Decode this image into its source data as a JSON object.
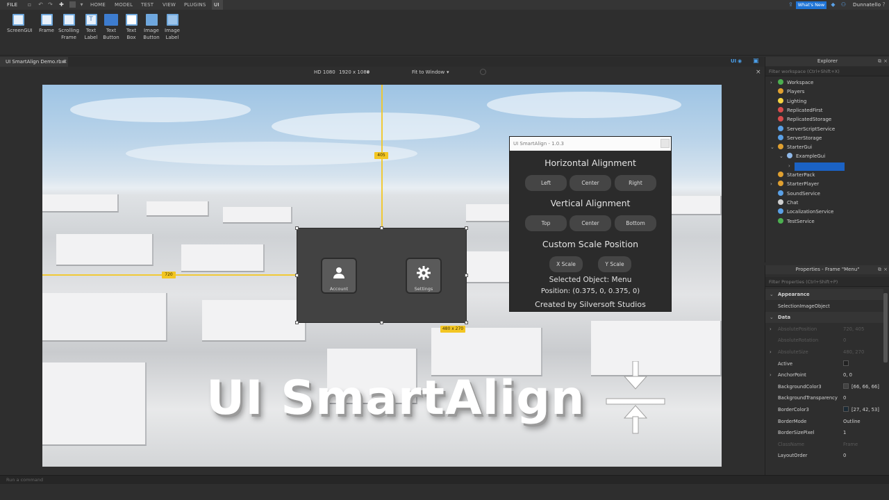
{
  "menubar": {
    "file_label": "FILE",
    "tabs": [
      "HOME",
      "MODEL",
      "TEST",
      "VIEW",
      "PLUGINS",
      "UI"
    ],
    "whats_new": "What's New",
    "username": "Dunnatello"
  },
  "ribbon": {
    "items": [
      {
        "label": "ScreenGUI",
        "icon": "screengui-icon"
      },
      {
        "label": "Frame",
        "icon": "frame-icon"
      },
      {
        "label": "Scrolling\nFrame",
        "icon": "scrolling-frame-icon"
      },
      {
        "label": "Text\nLabel",
        "icon": "text-label-icon"
      },
      {
        "label": "Text\nButton",
        "icon": "text-button-icon"
      },
      {
        "label": "Text\nBox",
        "icon": "text-box-icon"
      },
      {
        "label": "Image\nButton",
        "icon": "image-button-icon"
      },
      {
        "label": "Image\nLabel",
        "icon": "image-label-icon"
      }
    ]
  },
  "document_tab": "UI SmartAlign Demo.rbxl",
  "viewport_toolbar": {
    "device": "HD 1080",
    "resolution": "1920 x 1080",
    "fit": "Fit to Window",
    "ui_toggle": "UI"
  },
  "guides": {
    "vertical_badge": "405",
    "horizontal_badge": "720",
    "size_badge": "480 x 270"
  },
  "menu_frame": {
    "buttons": [
      {
        "label": "Account",
        "icon": "user-icon"
      },
      {
        "label": "Settings",
        "icon": "gear-icon"
      }
    ]
  },
  "widget": {
    "title": "UI SmartAlign - 1.0.3",
    "horizontal_heading": "Horizontal Alignment",
    "horizontal_buttons": [
      "Left",
      "Center",
      "Right"
    ],
    "vertical_heading": "Vertical Alignment",
    "vertical_buttons": [
      "Top",
      "Center",
      "Bottom"
    ],
    "scale_heading": "Custom Scale Position",
    "scale_buttons": [
      "X Scale",
      "Y Scale"
    ],
    "selected": "Selected Object: Menu",
    "position": "Position: (0.375, 0, 0.375, 0)",
    "credit": "Created by Silversoft Studios"
  },
  "banner_text": "UI SmartAlign",
  "explorer": {
    "title": "Explorer",
    "filter_placeholder": "Filter workspace (Ctrl+Shift+X)",
    "items": [
      {
        "label": "Workspace",
        "color": "#4caf50",
        "indent": 0,
        "arrow": true
      },
      {
        "label": "Players",
        "color": "#e0a030",
        "indent": 0,
        "arrow": false
      },
      {
        "label": "Lighting",
        "color": "#f5d442",
        "indent": 0,
        "arrow": false
      },
      {
        "label": "ReplicatedFirst",
        "color": "#d94c4c",
        "indent": 0,
        "arrow": false
      },
      {
        "label": "ReplicatedStorage",
        "color": "#d94c4c",
        "indent": 0,
        "arrow": false
      },
      {
        "label": "ServerScriptService",
        "color": "#5aa0e6",
        "indent": 0,
        "arrow": false
      },
      {
        "label": "ServerStorage",
        "color": "#5aa0e6",
        "indent": 0,
        "arrow": false
      },
      {
        "label": "StarterGui",
        "color": "#e0a030",
        "indent": 0,
        "arrow": true
      },
      {
        "label": "ExampleGui",
        "color": "#8fb8e8",
        "indent": 1,
        "arrow": true
      },
      {
        "label": "Menu",
        "color": "#cfe0f5",
        "indent": 2,
        "arrow": true
      },
      {
        "label": "StarterPack",
        "color": "#e0a030",
        "indent": 0,
        "arrow": false
      },
      {
        "label": "StarterPlayer",
        "color": "#e0a030",
        "indent": 0,
        "arrow": true
      },
      {
        "label": "SoundService",
        "color": "#5aa0e6",
        "indent": 0,
        "arrow": false
      },
      {
        "label": "Chat",
        "color": "#cfcfcf",
        "indent": 0,
        "arrow": false
      },
      {
        "label": "LocalizationService",
        "color": "#5aa0e6",
        "indent": 0,
        "arrow": false
      },
      {
        "label": "TestService",
        "color": "#4caf50",
        "indent": 0,
        "arrow": false
      }
    ]
  },
  "properties": {
    "title": "Properties - Frame \"Menu\"",
    "filter_placeholder": "Filter Properties (Ctrl+Shift+P)",
    "rows": [
      {
        "key": "Appearance",
        "value": "",
        "kind": "cat"
      },
      {
        "key": "SelectionImageObject",
        "value": "",
        "kind": "row"
      },
      {
        "key": "Data",
        "value": "",
        "kind": "cat"
      },
      {
        "key": "AbsolutePosition",
        "value": "720, 405",
        "kind": "dim"
      },
      {
        "key": "AbsoluteRotation",
        "value": "0",
        "kind": "dim"
      },
      {
        "key": "AbsoluteSize",
        "value": "480, 270",
        "kind": "dim"
      },
      {
        "key": "Active",
        "value": "",
        "kind": "row"
      },
      {
        "key": "AnchorPoint",
        "value": "0, 0",
        "kind": "row"
      },
      {
        "key": "BackgroundColor3",
        "value": "[66, 66, 66]",
        "kind": "row",
        "swatch": "#424242"
      },
      {
        "key": "BackgroundTransparency",
        "value": "0",
        "kind": "row"
      },
      {
        "key": "BorderColor3",
        "value": "[27, 42, 53]",
        "kind": "row",
        "swatch": "#1b2a35"
      },
      {
        "key": "BorderMode",
        "value": "Outline",
        "kind": "row"
      },
      {
        "key": "BorderSizePixel",
        "value": "1",
        "kind": "row"
      },
      {
        "key": "ClassName",
        "value": "Frame",
        "kind": "dim"
      },
      {
        "key": "LayoutOrder",
        "value": "0",
        "kind": "row"
      }
    ]
  },
  "command_placeholder": "Run a command"
}
